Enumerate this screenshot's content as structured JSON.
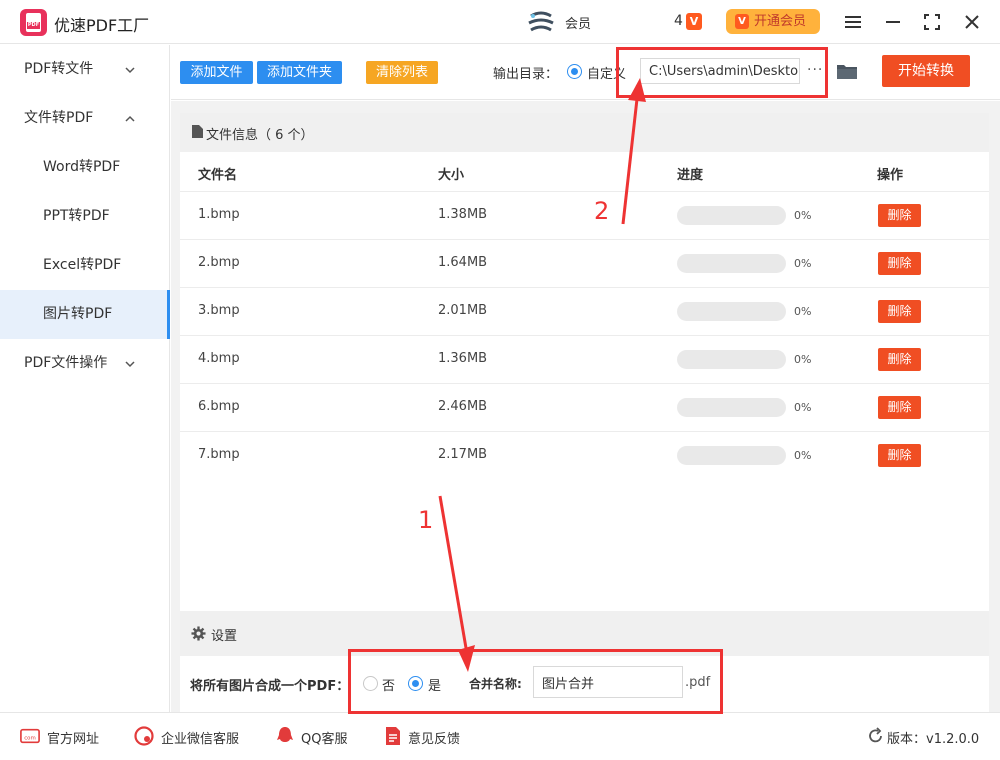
{
  "app": {
    "title": "优速PDF工厂",
    "logo_text": "PDF"
  },
  "header": {
    "user_name": "会员",
    "msg_count": "4",
    "vip_icon_text": "V",
    "vip_button": "开通会员"
  },
  "sidebar": {
    "items": [
      {
        "label": "PDF转文件"
      },
      {
        "label": "文件转PDF"
      },
      {
        "label": "Word转PDF"
      },
      {
        "label": "PPT转PDF"
      },
      {
        "label": "Excel转PDF"
      },
      {
        "label": "图片转PDF"
      },
      {
        "label": "PDF文件操作"
      }
    ]
  },
  "toolbar": {
    "add_file": "添加文件",
    "add_folder": "添加文件夹",
    "clear_list": "清除列表",
    "output_label": "输出目录：",
    "custom_label": "自定义",
    "output_path": "C:\\Users\\admin\\Deskto",
    "more": "···",
    "start": "开始转换"
  },
  "file_panel": {
    "title": "文件信息（ 6 个）",
    "columns": [
      "文件名",
      "大小",
      "进度",
      "操作"
    ],
    "rows": [
      {
        "name": "1.bmp",
        "size": "1.38MB",
        "progress": "0%",
        "progress_value": 0,
        "action": "删除"
      },
      {
        "name": "2.bmp",
        "size": "1.64MB",
        "progress": "0%",
        "progress_value": 0,
        "action": "删除"
      },
      {
        "name": "3.bmp",
        "size": "2.01MB",
        "progress": "0%",
        "progress_value": 0,
        "action": "删除"
      },
      {
        "name": "4.bmp",
        "size": "1.36MB",
        "progress": "0%",
        "progress_value": 0,
        "action": "删除"
      },
      {
        "name": "6.bmp",
        "size": "2.46MB",
        "progress": "0%",
        "progress_value": 0,
        "action": "删除"
      },
      {
        "name": "7.bmp",
        "size": "2.17MB",
        "progress": "0%",
        "progress_value": 0,
        "action": "删除"
      }
    ]
  },
  "settings": {
    "title": "设置",
    "merge_label": "将所有图片合成一个PDF：",
    "option_no": "否",
    "option_yes": "是",
    "merge_selected": "是",
    "name_label": "合并名称:",
    "name_value": "图片合并",
    "extension": ".pdf"
  },
  "footer": {
    "website": "官方网址",
    "wechat": "企业微信客服",
    "qq": "QQ客服",
    "feedback": "意见反馈",
    "version": "版本：v1.2.0.0"
  },
  "annotations": {
    "label_1": "1",
    "label_2": "2"
  },
  "colors": {
    "primary": "#2d8ef0",
    "danger": "#f04e23",
    "warning": "#f6a623",
    "annotation": "#ee3333",
    "vip": "#ffb23c"
  }
}
